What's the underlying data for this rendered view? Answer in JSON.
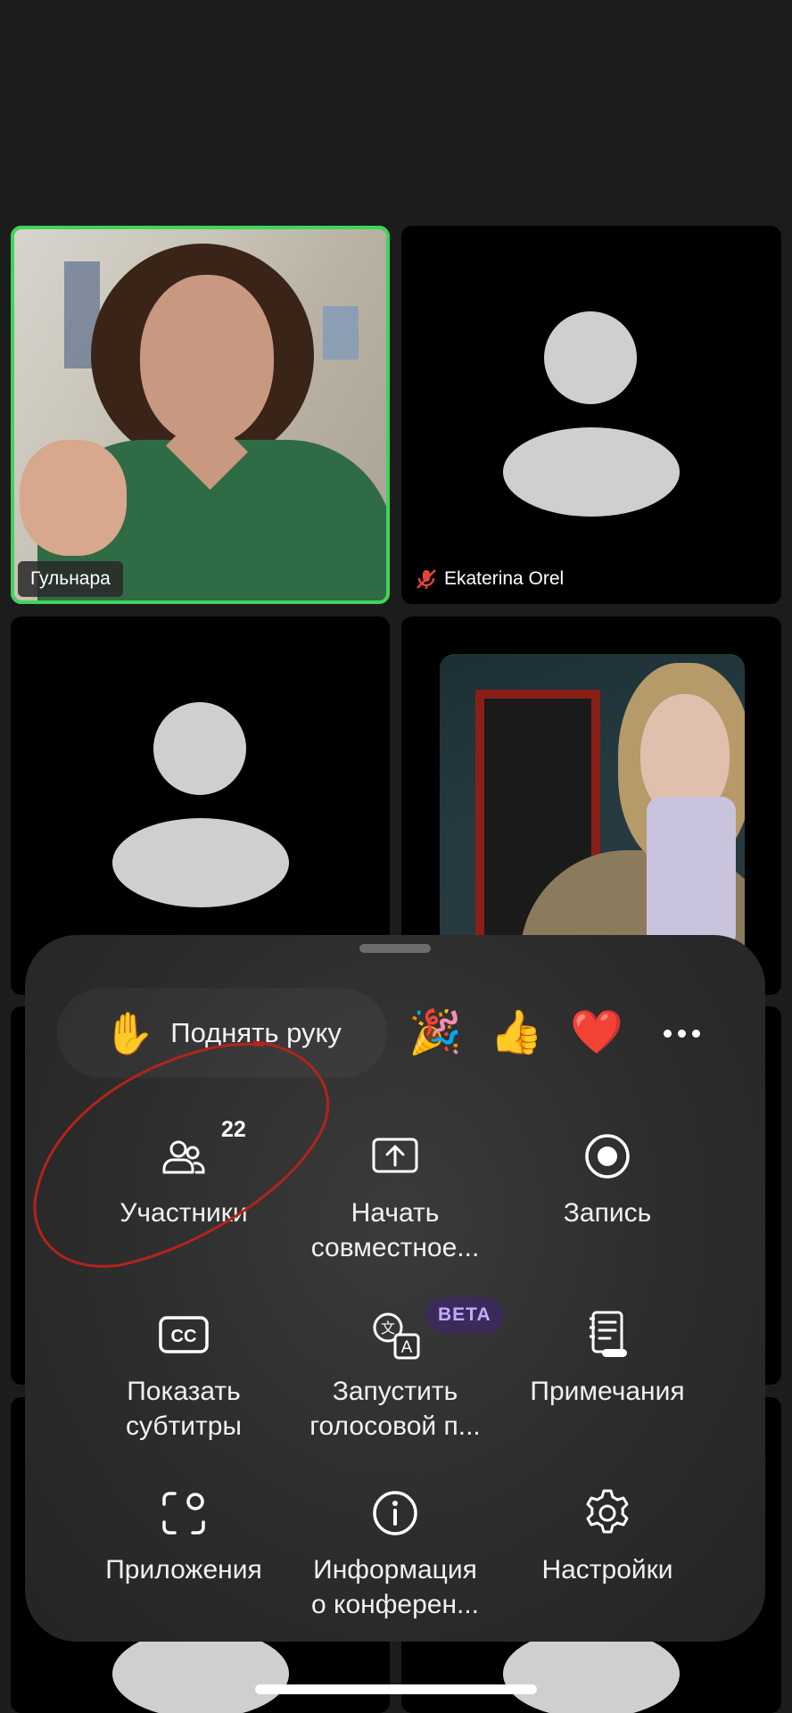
{
  "participants": [
    {
      "name": "Гульнара",
      "speaking": true,
      "video": true,
      "muted": false
    },
    {
      "name": "Ekaterina Orel",
      "speaking": false,
      "video": false,
      "muted": true
    },
    {
      "name": "",
      "speaking": false,
      "video": false,
      "muted": false
    },
    {
      "name": "",
      "speaking": false,
      "video": true,
      "muted": false
    }
  ],
  "colors": {
    "speaking_border": "#3fd45a",
    "muted_icon": "#e0433a",
    "beta_badge_bg": "#3a2b5a",
    "beta_badge_text": "#c7a9ff",
    "annotation_circle": "#b3231b"
  },
  "sheet": {
    "raise_hand": {
      "emoji": "✋",
      "label": "Поднять руку"
    },
    "reactions": [
      {
        "name": "party-popper",
        "emoji": "🎉"
      },
      {
        "name": "thumbs-up",
        "emoji": "👍"
      },
      {
        "name": "heart",
        "emoji": "❤️"
      }
    ],
    "more_icon": "more-horizontal-icon",
    "items": [
      {
        "icon": "participants-icon",
        "label": "Участники",
        "count": "22"
      },
      {
        "icon": "share-screen-icon",
        "label": "Начать\nсовместное..."
      },
      {
        "icon": "record-icon",
        "label": "Запись"
      },
      {
        "icon": "closed-captions-icon",
        "label": "Показать\nсубтитры"
      },
      {
        "icon": "translate-icon",
        "label": "Запустить\nголосовой п...",
        "badge": "BETA"
      },
      {
        "icon": "notes-icon",
        "label": "Примечания"
      },
      {
        "icon": "apps-icon",
        "label": "Приложения"
      },
      {
        "icon": "info-icon",
        "label": "Информация\nо конферен..."
      },
      {
        "icon": "settings-icon",
        "label": "Настройки"
      }
    ]
  }
}
